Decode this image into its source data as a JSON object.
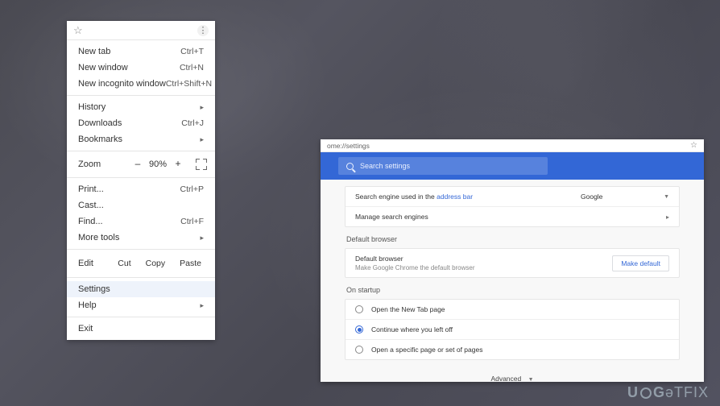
{
  "menu": {
    "section1": [
      {
        "label": "New tab",
        "shortcut": "Ctrl+T"
      },
      {
        "label": "New window",
        "shortcut": "Ctrl+N"
      },
      {
        "label": "New incognito window",
        "shortcut": "Ctrl+Shift+N"
      }
    ],
    "section2": [
      {
        "label": "History",
        "arrow": "▸"
      },
      {
        "label": "Downloads",
        "shortcut": "Ctrl+J"
      },
      {
        "label": "Bookmarks",
        "arrow": "▸"
      }
    ],
    "zoom": {
      "label": "Zoom",
      "minus": "–",
      "value": "90%",
      "plus": "+"
    },
    "section3": [
      {
        "label": "Print...",
        "shortcut": "Ctrl+P"
      },
      {
        "label": "Cast...",
        "shortcut": ""
      },
      {
        "label": "Find...",
        "shortcut": "Ctrl+F"
      },
      {
        "label": "More tools",
        "arrow": "▸"
      }
    ],
    "edit": {
      "label": "Edit",
      "cut": "Cut",
      "copy": "Copy",
      "paste": "Paste"
    },
    "section4": [
      {
        "label": "Settings",
        "highlight": true
      },
      {
        "label": "Help",
        "arrow": "▸"
      }
    ],
    "section5": [
      {
        "label": "Exit"
      }
    ]
  },
  "settings": {
    "url": "ome://settings",
    "search_placeholder": "Search settings",
    "search_engine": {
      "row_prefix": "Search engine used in the ",
      "row_link": "address bar",
      "selected": "Google",
      "manage": "Manage search engines"
    },
    "default_browser": {
      "section": "Default browser",
      "title": "Default browser",
      "subtitle": "Make Google Chrome the default browser",
      "button": "Make default"
    },
    "on_startup": {
      "section": "On startup",
      "options": [
        {
          "label": "Open the New Tab page",
          "checked": false
        },
        {
          "label": "Continue where you left off",
          "checked": true
        },
        {
          "label": "Open a specific page or set of pages",
          "checked": false
        }
      ]
    },
    "advanced": "Advanced"
  },
  "watermark": {
    "pre": "U",
    "mid": "G",
    "post": "TFIX"
  }
}
